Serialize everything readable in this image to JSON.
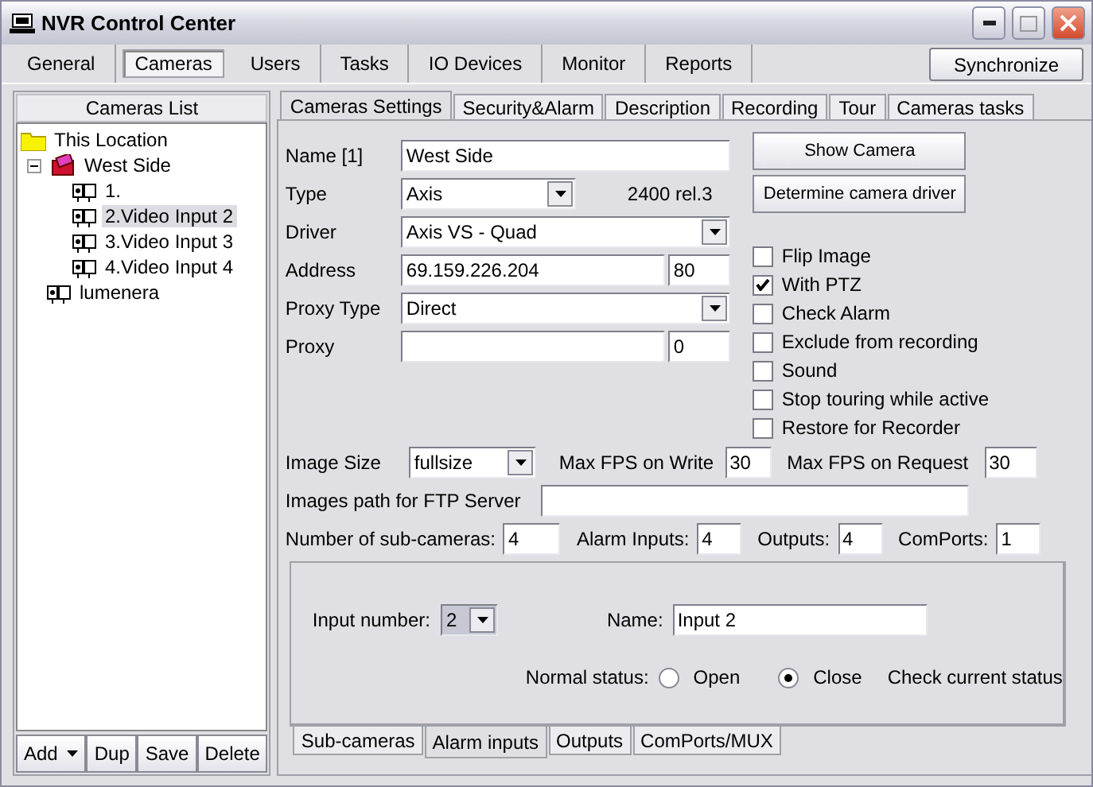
{
  "window": {
    "title": "NVR Control Center"
  },
  "main_tabs": [
    {
      "label": "General",
      "selected": false
    },
    {
      "label": "Cameras",
      "selected": true
    },
    {
      "label": "Users",
      "selected": false
    },
    {
      "label": "Tasks",
      "selected": false
    },
    {
      "label": "IO Devices",
      "selected": false
    },
    {
      "label": "Monitor",
      "selected": false
    },
    {
      "label": "Reports",
      "selected": false
    }
  ],
  "sync_button": "Synchronize",
  "cameras_list": {
    "header": "Cameras List",
    "tree": [
      {
        "label": "This Location",
        "kind": "folder",
        "selected": false,
        "children": [
          {
            "label": "West Side",
            "kind": "site",
            "selected": false,
            "expanded": true,
            "children": [
              {
                "label": "1.",
                "kind": "camera",
                "selected": false
              },
              {
                "label": "2.Video Input 2",
                "kind": "camera",
                "selected": true
              },
              {
                "label": "3.Video Input 3",
                "kind": "camera",
                "selected": false
              },
              {
                "label": "4.Video Input 4",
                "kind": "camera",
                "selected": false
              }
            ]
          },
          {
            "label": "lumenera",
            "kind": "camera",
            "selected": false
          }
        ]
      }
    ]
  },
  "list_buttons": [
    {
      "label": "Add",
      "kind": "split"
    },
    {
      "label": "Dup",
      "kind": "plain"
    },
    {
      "label": "Save",
      "kind": "plain"
    },
    {
      "label": "Delete",
      "kind": "plain"
    }
  ],
  "settings_tabs": [
    {
      "label": "Cameras Settings",
      "selected": true
    },
    {
      "label": "Security&Alarm",
      "selected": false
    },
    {
      "label": "Description",
      "selected": false
    },
    {
      "label": "Recording",
      "selected": false
    },
    {
      "label": "Tour",
      "selected": false
    },
    {
      "label": "Cameras tasks",
      "selected": false
    }
  ],
  "camera_form": {
    "fields": [
      {
        "label": "Name [1]",
        "kind": "text",
        "value": "West Side"
      },
      {
        "label": "Type",
        "kind": "select",
        "value": "Axis",
        "note": "2400 rel.3"
      },
      {
        "label": "Driver",
        "kind": "select",
        "value": "Axis VS - Quad"
      },
      {
        "label": "Address",
        "kind": "text",
        "value": "69.159.226.204",
        "port": "80"
      },
      {
        "label": "Proxy Type",
        "kind": "select",
        "value": "Direct"
      },
      {
        "label": "Proxy",
        "kind": "text",
        "port": "0"
      }
    ]
  },
  "actions": [
    "Show Camera",
    "Determine camera driver"
  ],
  "options": [
    {
      "label": "Flip Image",
      "checked": false
    },
    {
      "label": "With PTZ",
      "checked": true
    },
    {
      "label": "Check Alarm",
      "checked": false
    },
    {
      "label": "Exclude from recording",
      "checked": false
    },
    {
      "label": "Sound",
      "checked": false
    },
    {
      "label": "Stop touring while active",
      "checked": false
    },
    {
      "label": "Restore for Recorder",
      "checked": false
    }
  ],
  "image_row": {
    "image_size_label": "Image Size",
    "image_size": "fullsize",
    "max_fps_write_label": "Max FPS on Write",
    "max_fps_write": "30",
    "max_fps_request_label": "Max FPS on Request",
    "max_fps_request": "30"
  },
  "ftp": {
    "label": "Images path for FTP Server"
  },
  "counts": [
    {
      "label": "Number of sub-cameras:",
      "value": "4"
    },
    {
      "label": "Alarm Inputs:",
      "value": "4"
    },
    {
      "label": "Outputs:",
      "value": "4"
    },
    {
      "label": "ComPorts:",
      "value": "1"
    }
  ],
  "alarm_inputs": {
    "input_number_label": "Input number:",
    "input_number": "2",
    "name_label": "Name:",
    "name": "Input 2",
    "normal_status_label": "Normal status:",
    "statuses": [
      {
        "label": "Open",
        "selected": false
      },
      {
        "label": "Close",
        "selected": true
      }
    ],
    "check_link": "Check current status"
  },
  "bottom_tabs": [
    {
      "label": "Sub-cameras",
      "selected": false
    },
    {
      "label": "Alarm inputs",
      "selected": true
    },
    {
      "label": "Outputs",
      "selected": false
    },
    {
      "label": "ComPorts/MUX",
      "selected": false
    }
  ]
}
